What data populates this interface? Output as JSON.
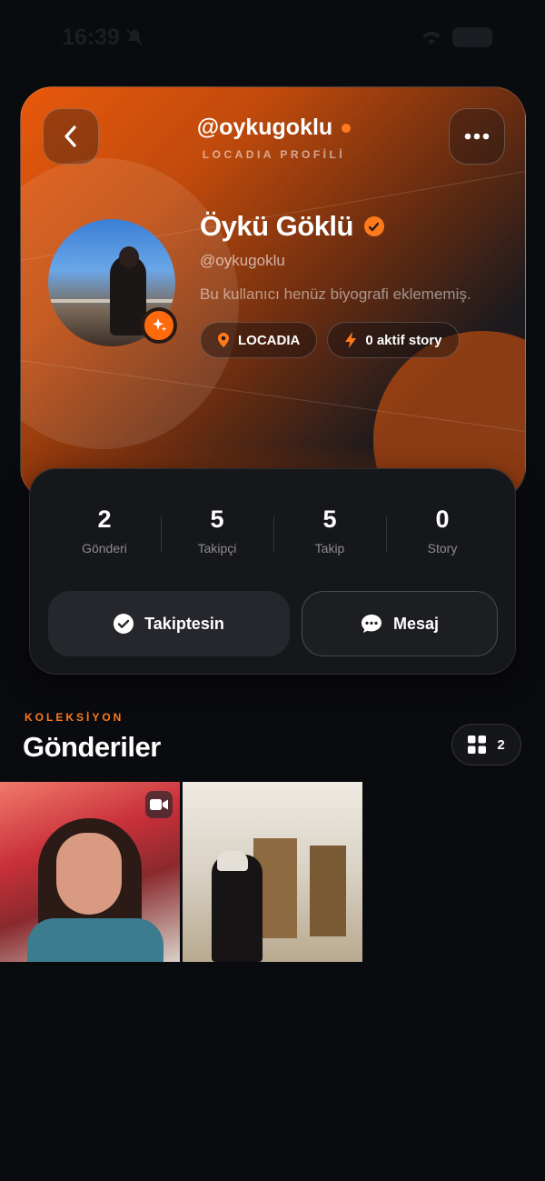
{
  "status_bar": {
    "time": "16:39"
  },
  "header": {
    "handle": "@oykugoklu",
    "subtitle": "LOCADIA PROFİLİ"
  },
  "profile": {
    "name": "Öykü Göklü",
    "username": "@oykugoklu",
    "bio": "Bu kullanıcı henüz biyografi eklememiş.",
    "location_chip": "LOCADIA",
    "story_chip": "0 aktif story"
  },
  "stats": [
    {
      "value": "2",
      "label": "Gönderi"
    },
    {
      "value": "5",
      "label": "Takipçi"
    },
    {
      "value": "5",
      "label": "Takip"
    },
    {
      "value": "0",
      "label": "Story"
    }
  ],
  "actions": {
    "follow_label": "Takiptesin",
    "message_label": "Mesaj"
  },
  "posts_section": {
    "kicker": "KOLEKSİYON",
    "title": "Gönderiler",
    "count": "2",
    "posts": [
      {
        "type": "video"
      },
      {
        "type": "image"
      }
    ]
  },
  "colors": {
    "accent": "#ff7a1a",
    "background": "#0a0b0e",
    "card": "#16171b"
  },
  "icons": [
    "back-icon",
    "more-icon",
    "sparkle-icon",
    "verified-icon",
    "location-icon",
    "bolt-icon",
    "check-circle-icon",
    "chat-icon",
    "grid-icon",
    "video-icon"
  ]
}
